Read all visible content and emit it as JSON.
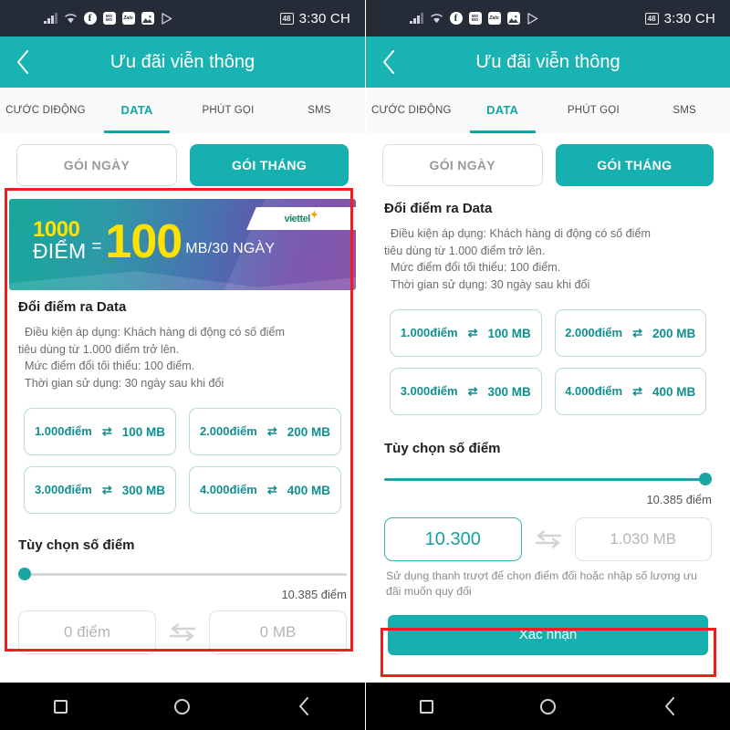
{
  "status_bar": {
    "time": "3:30 CH",
    "battery_level": "48",
    "icons": [
      "signal-bars-icon",
      "wifi-icon",
      "facebook-icon",
      "momo-icon",
      "zalo-icon",
      "gallery-icon",
      "play-store-icon"
    ],
    "momo_label": "MO MO",
    "zalo_label": "Zalo"
  },
  "header": {
    "title": "Ưu đãi viễn thông",
    "back_icon": "chevron-left-icon"
  },
  "tabs": [
    {
      "label": "CƯỚC DI ĐỘNG",
      "line1": "CƯỚC DI",
      "line2": "ĐỘNG",
      "active": false
    },
    {
      "label": "DATA",
      "line1": "DATA",
      "line2": "",
      "active": true
    },
    {
      "label": "PHÚT GỌI",
      "line1": "PHÚT GỌI",
      "line2": "",
      "active": false
    },
    {
      "label": "SMS",
      "line1": "SMS",
      "line2": "",
      "active": false
    }
  ],
  "package_toggle": {
    "day_label": "GÓI NGÀY",
    "month_label": "GÓI THÁNG",
    "selected": "GÓI THÁNG"
  },
  "banner": {
    "points": "1000",
    "points_unit": "ĐIỂM",
    "equals": "=",
    "data_amount": "100",
    "data_unit": "MB/30 NGÀY",
    "brand": "viettel",
    "brand_star": "✦"
  },
  "section": {
    "title": "Đổi điểm ra Data",
    "desc_line1": "Điều kiện áp dụng: Khách hàng di động có số điểm",
    "desc_line2": "tiêu dùng từ 1.000 điểm trở lên.",
    "desc_line3": "Mức điểm đổi tối thiểu: 100 điểm.",
    "desc_line4": "Thời gian sử dụng: 30 ngày sau khi đổi"
  },
  "options": [
    {
      "points": "1.000",
      "points_unit": "điểm",
      "swap_icon": "swap-icon",
      "data": "100 MB"
    },
    {
      "points": "2.000",
      "points_unit": "điểm",
      "swap_icon": "swap-icon",
      "data": "200 MB"
    },
    {
      "points": "3.000",
      "points_unit": "điểm",
      "swap_icon": "swap-icon",
      "data": "300 MB"
    },
    {
      "points": "4.000",
      "points_unit": "điểm",
      "swap_icon": "swap-icon",
      "data": "400 MB"
    }
  ],
  "slider_section": {
    "title": "Tùy chọn số điểm",
    "max_label": "10.385 điểm"
  },
  "left_panel": {
    "slider_percent": 0,
    "points_value": "0 điểm",
    "data_value": "0 MB"
  },
  "right_panel": {
    "slider_percent": 100,
    "points_value": "10.300",
    "data_value": "1.030 MB",
    "hint_line1": "Sử dụng thanh trượt để chọn điểm đổi hoặc nhập số lượng ưu",
    "hint_line2": "đãi muốn quy đổi",
    "confirm_label": "Xác nhận"
  },
  "nav_bar": {
    "recents_icon": "square-icon",
    "home_icon": "circle-icon",
    "back_icon": "chevron-left-icon"
  },
  "colors": {
    "teal": "#16b0b0",
    "teal_dark": "#11a6a6",
    "highlight_red": "#f31d1d",
    "banner_yellow": "#ffe200",
    "status_bar": "#262b38"
  }
}
